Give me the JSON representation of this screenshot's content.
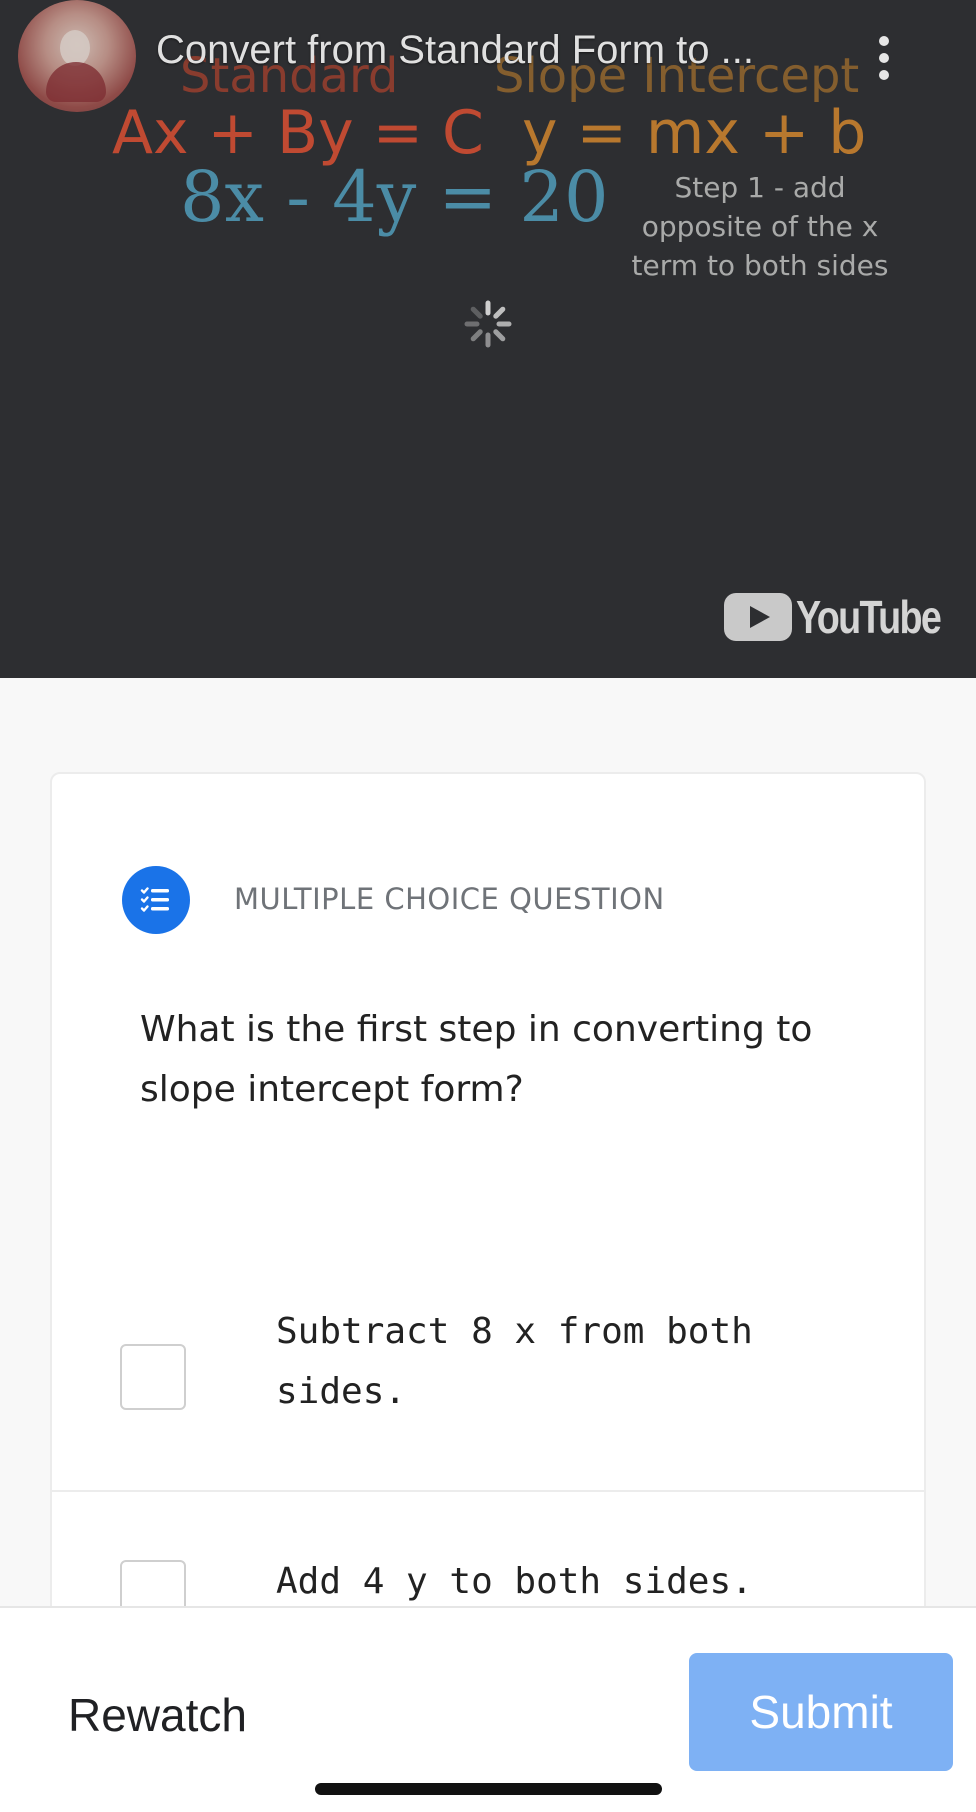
{
  "video": {
    "title": "Convert from Standard Form to ...",
    "more_icon": "more-vert-icon",
    "board": {
      "standard_heading": "Standard",
      "slope_heading": "Slope Intercept",
      "standard_equation": "Ax + By = C",
      "slope_equation": "y = mx + b",
      "example_equation": "8x - 4y  =  20",
      "step_note": "Step 1 - add opposite of the x term to both sides"
    },
    "loading_icon": "spinner-icon",
    "brand": "YouTube"
  },
  "question": {
    "type_label": "MULTIPLE CHOICE QUESTION",
    "type_icon": "checklist-icon",
    "type_icon_color": "#1a73e8",
    "text": "What is the first step in converting to slope intercept form?",
    "options": [
      {
        "label": "Subtract 8 x from both sides.",
        "checked": false
      },
      {
        "label": "Add 4 y to both sides.",
        "checked": false
      }
    ]
  },
  "footer": {
    "rewatch_label": "Rewatch",
    "submit_label": "Submit",
    "submit_color": "#7eb1f4"
  }
}
